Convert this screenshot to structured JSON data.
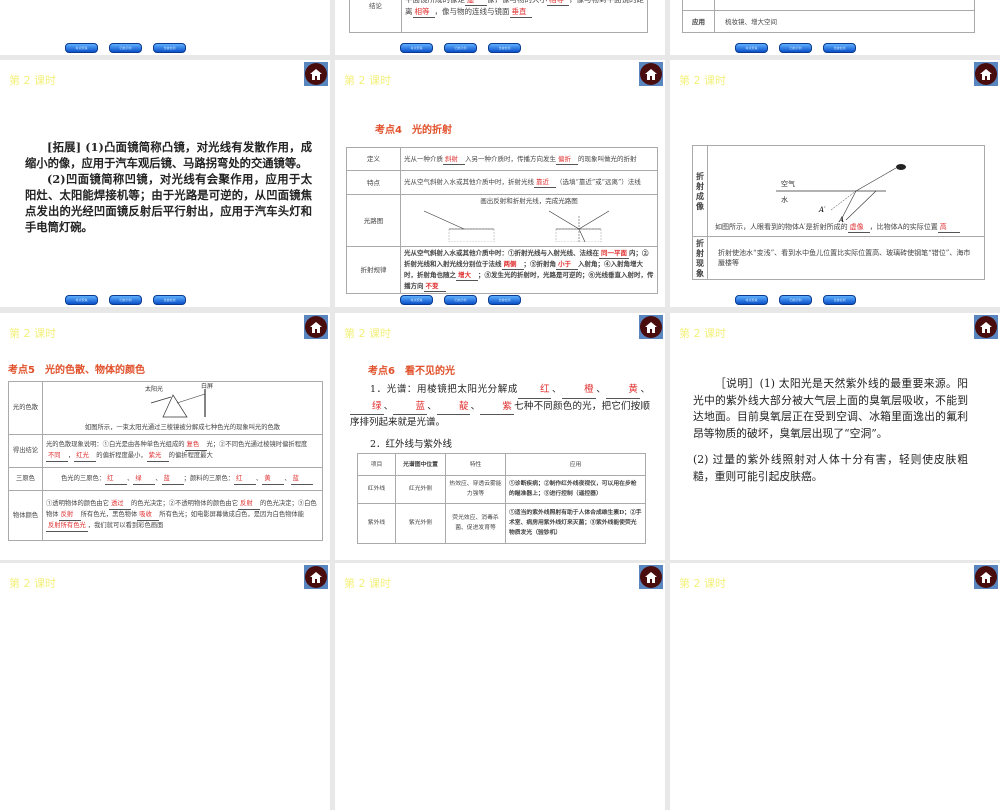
{
  "common": {
    "lesson_header": "第 2 课时",
    "nav_buttons": [
      "考点聚焦",
      "归类示例",
      "当堂检测"
    ]
  },
  "slides": {
    "s0b": {
      "label": "结论",
      "text": [
        {
          "t": "平面镜所成的像是"
        },
        {
          "t": "虚",
          "a": 1
        },
        {
          "t": "像，像与物的大小"
        },
        {
          "t": "相等",
          "a": 1
        },
        {
          "t": "，像与物到平面镜的距离"
        },
        {
          "t": "相等",
          "a": 1
        },
        {
          "t": "，像与物的连线与镜面"
        },
        {
          "t": "垂直",
          "a": 1
        }
      ]
    },
    "s0c": {
      "label": "应用",
      "text": "梳妆镜、增大空间"
    },
    "s1a": {
      "text": [
        {
          "t": "[拓展] (1)凸面镜简称凸镜，对光线有发散作用，成缩小的像，应用于汽车观后镜、马路拐弯处的交通镜等。"
        }
      ],
      "text2": "(2)凹面镜简称凹镜，对光线有会聚作用，应用于太阳灶、太阳能焊接机等；由于光路是可逆的，从凹面镜焦点发出的光经凹面镜反射后平行射出，应用于汽车头灯和手电筒灯碗。"
    },
    "s1b": {
      "title": "考点4　光的折射",
      "rows": [
        {
          "label": "定义",
          "text": [
            {
              "t": "光从一种介质"
            },
            {
              "t": "斜射",
              "a": 1
            },
            {
              "t": "入另一种介质时，传播方向发生"
            },
            {
              "t": "偏折",
              "a": 1
            },
            {
              "t": "的现象叫做光的折射"
            }
          ]
        },
        {
          "label": "特点",
          "text": [
            {
              "t": "光从空气斜射入水或其他介质中时，折射光线"
            },
            {
              "t": "靠近",
              "a": 1
            },
            {
              "t": "（选填“靠近”或“远离”）法线"
            }
          ]
        },
        {
          "label": "光路图",
          "text": [
            {
              "t": "画出反射和折射光线，完成光路图"
            }
          ]
        },
        {
          "label": "折射规律",
          "text": [
            {
              "t": "光从空气斜射入水或其他介质中时：①折射光线与入射光线、法线在"
            },
            {
              "t": "同一平面",
              "a": 1
            },
            {
              "t": "内；②折射光线和入射光线分别位于法线"
            },
            {
              "t": "两侧",
              "a": 1
            },
            {
              "t": "；③折射角"
            },
            {
              "t": "小于",
              "a": 1
            },
            {
              "t": "入射角；④入射角增大时，折射角也随之"
            },
            {
              "t": "增大",
              "a": 1
            },
            {
              "t": "；⑤发生光的折射时，光路是可逆的；⑥光线垂直入射时，传播方向"
            },
            {
              "t": "不变",
              "a": 1
            }
          ]
        }
      ]
    },
    "s1c": {
      "rows": [
        {
          "label": "折射成像",
          "diagram": {
            "air": "空气",
            "water": "水",
            "a_img": "A′",
            "a": "A"
          },
          "text": [
            {
              "t": "如图所示，人眼看到的物体A′是折射所成的"
            },
            {
              "t": "虚像",
              "a": 1
            },
            {
              "t": "，比物体A的实际位置"
            },
            {
              "t": "高",
              "a": 1
            }
          ]
        },
        {
          "label": "折射现象",
          "text": [
            {
              "t": "折射使池水“变浅”、看到水中鱼儿位置比实际位置高、玻璃砖使钢笔“错位”、海市蜃楼等"
            }
          ]
        }
      ]
    },
    "s2a": {
      "title": "考点5　光的色散、物体的颜色",
      "diagram": {
        "sun": "太阳光",
        "screen": "白屏"
      },
      "rows": [
        {
          "label": "光的色散",
          "text": [
            {
              "t": "如图所示，一束太阳光通过三棱镜被分解成七种色光的现象叫光的色散"
            }
          ]
        },
        {
          "label": "得出结论",
          "text": [
            {
              "t": "光的色散现象说明：①白光是由各种单色光组成的"
            },
            {
              "t": "复色",
              "a": 1
            },
            {
              "t": "光；②不同色光通过棱镜时偏折程度"
            },
            {
              "t": "不同",
              "a": 1
            },
            {
              "t": "，"
            },
            {
              "t": "红光",
              "a": 1
            },
            {
              "t": "的偏折程度最小，"
            },
            {
              "t": "紫光",
              "a": 1
            },
            {
              "t": "的偏折程度最大"
            }
          ]
        },
        {
          "label": "三原色",
          "text": [
            {
              "t": "色光的三原色："
            },
            {
              "t": "红",
              "a": 1
            },
            {
              "t": "、"
            },
            {
              "t": "绿",
              "a": 1
            },
            {
              "t": "、"
            },
            {
              "t": "蓝",
              "a": 1
            },
            {
              "t": "；颜料的三原色："
            },
            {
              "t": "红",
              "a": 1
            },
            {
              "t": "、"
            },
            {
              "t": "黄",
              "a": 1
            },
            {
              "t": "、"
            },
            {
              "t": "蓝",
              "a": 1
            }
          ]
        },
        {
          "label": "物体颜色",
          "text": [
            {
              "t": "①透明物体的颜色由它"
            },
            {
              "t": "透过",
              "a": 1
            },
            {
              "t": "的色光决定；②不透明物体的颜色由它"
            },
            {
              "t": "反射",
              "a": 1
            },
            {
              "t": "的色光决定；③白色物体"
            },
            {
              "t": "反射",
              "a": 1
            },
            {
              "t": "所有色光，黑色物体"
            },
            {
              "t": "吸收",
              "a": 1
            },
            {
              "t": "所有色光；如电影屏幕做成白色，是因为白色物体能"
            },
            {
              "t": "反射所有色光",
              "a": 1
            },
            {
              "t": "，我们就可以看到彩色画面"
            }
          ]
        }
      ]
    },
    "s2b": {
      "title": "考点6　看不见的光",
      "p1": [
        {
          "t": "1．光谱：用棱镜把太阳光分解成"
        },
        {
          "t": "红",
          "a": 1
        },
        {
          "t": "、"
        },
        {
          "t": "橙",
          "a": 1
        },
        {
          "t": "、"
        },
        {
          "t": "黄",
          "a": 1
        },
        {
          "t": "、"
        },
        {
          "t": "绿",
          "a": 1
        },
        {
          "t": "、"
        },
        {
          "t": "蓝",
          "a": 1
        },
        {
          "t": "、"
        },
        {
          "t": "靛",
          "a": 1
        },
        {
          "t": "、"
        },
        {
          "t": "紫",
          "a": 1
        },
        {
          "t": "七种不同颜色的光，把它们按顺序排列起来就是光谱。"
        }
      ],
      "p2": "2．红外线与紫外线",
      "table": {
        "headers": [
          "项目",
          "光谱图中位置",
          "特性",
          "应用"
        ],
        "rows": [
          [
            "红外线",
            "红光外侧",
            "热效应、穿透云雾能力强等",
            "①诊断疾病；②制作红外线夜视仪，可以用在步枪的瞄准器上；③进行控制（遥控器）"
          ],
          [
            "紫外线",
            "紫光外侧",
            "荧光效应、消毒杀菌、促进发育等",
            "①适当的紫外线照射有助于人体合成维生素D；②手术室、病房用紫外线灯来灭菌；③紫外线能使荧光物质发光（验钞机）"
          ]
        ]
      }
    },
    "s2c": {
      "p1": "［说明］(1) 太阳光是天然紫外线的最重要来源。阳光中的紫外线大部分被大气层上面的臭氧层吸收，不能到达地面。目前臭氧层正在受到空调、冰箱里面逸出的氟利昂等物质的破坏，臭氧层出现了“空洞”。",
      "p2": "(2) 过量的紫外线照射对人体十分有害，轻则使皮肤粗糙，重则可能引起皮肤癌。"
    }
  }
}
